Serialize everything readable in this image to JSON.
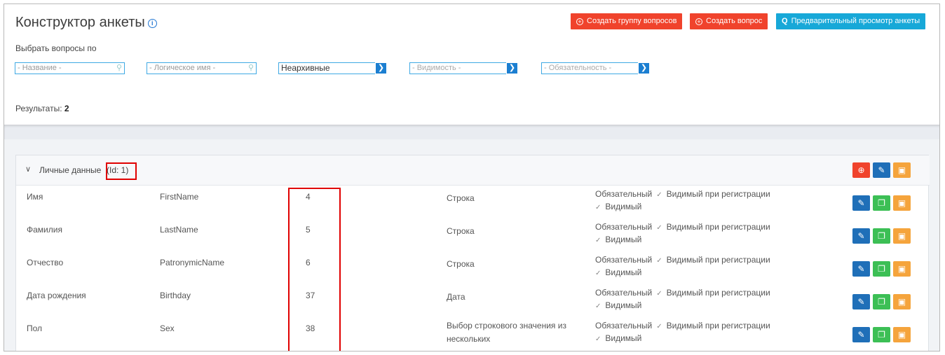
{
  "header": {
    "title": "Конструктор анкеты",
    "info_icon": "info-icon",
    "buttons": {
      "create_group": "Создать группу вопросов",
      "create_question": "Создать вопрос",
      "preview": "Предварительный просмотр анкеты"
    }
  },
  "filters": {
    "label": "Выбрать вопросы по",
    "name_placeholder": "- Название -",
    "logical_name_placeholder": "- Логическое имя -",
    "archive_value": "Неархивные",
    "visibility_placeholder": "- Видимость -",
    "required_placeholder": "- Обязательность -"
  },
  "results": {
    "label": "Результаты:",
    "count": "2"
  },
  "group": {
    "title": "Личные данные",
    "id_text": "(Id: 1)",
    "rows": [
      {
        "name": "Имя",
        "logical": "FirstName",
        "id": "4",
        "type": "Строка",
        "required": "Обязательный",
        "visible_reg": "Видимый при регистрации",
        "visible": "Видимый"
      },
      {
        "name": "Фамилия",
        "logical": "LastName",
        "id": "5",
        "type": "Строка",
        "required": "Обязательный",
        "visible_reg": "Видимый при регистрации",
        "visible": "Видимый"
      },
      {
        "name": "Отчество",
        "logical": "PatronymicName",
        "id": "6",
        "type": "Строка",
        "required": "Обязательный",
        "visible_reg": "Видимый при регистрации",
        "visible": "Видимый"
      },
      {
        "name": "Дата рождения",
        "logical": "Birthday",
        "id": "37",
        "type": "Дата",
        "required": "Обязательный",
        "visible_reg": "Видимый при регистрации",
        "visible": "Видимый"
      },
      {
        "name": "Пол",
        "logical": "Sex",
        "id": "38",
        "type": "Выбор строкового значения из нескольких",
        "required": "Обязательный",
        "visible_reg": "Видимый при регистрации",
        "visible": "Видимый"
      }
    ]
  },
  "colors": {
    "red": "#f0432c",
    "blue": "#1f6fb8",
    "orange": "#f5a43c",
    "green": "#3cbf55",
    "cyan": "#17a8d8",
    "highlight": "#e00000"
  }
}
